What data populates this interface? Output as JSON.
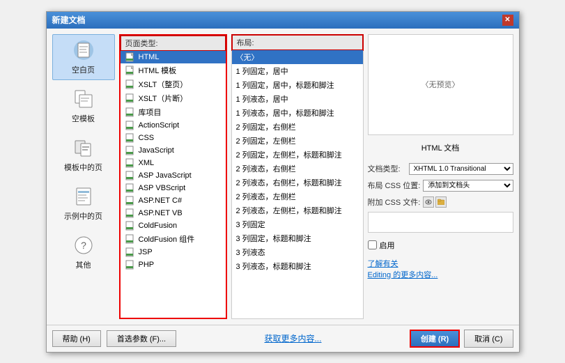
{
  "dialog": {
    "title": "新建文档",
    "close_label": "✕"
  },
  "sidebar": {
    "items": [
      {
        "id": "blank-page",
        "label": "空白页",
        "active": true
      },
      {
        "id": "blank-template",
        "label": "空模板"
      },
      {
        "id": "template-page",
        "label": "模板中的页"
      },
      {
        "id": "example-page",
        "label": "示例中的页"
      },
      {
        "id": "other",
        "label": "其他"
      }
    ]
  },
  "page_types": {
    "header": "页面类型:",
    "items": [
      {
        "id": "html",
        "label": "HTML",
        "selected": true
      },
      {
        "id": "html-template",
        "label": "HTML 模板"
      },
      {
        "id": "xslt-full",
        "label": "XSLT（整页）"
      },
      {
        "id": "xslt-fragment",
        "label": "XSLT（片断）"
      },
      {
        "id": "library",
        "label": "库项目"
      },
      {
        "id": "actionscript",
        "label": "ActionScript"
      },
      {
        "id": "css",
        "label": "CSS"
      },
      {
        "id": "javascript",
        "label": "JavaScript"
      },
      {
        "id": "xml",
        "label": "XML"
      },
      {
        "id": "asp-js",
        "label": "ASP JavaScript"
      },
      {
        "id": "asp-vbs",
        "label": "ASP VBScript"
      },
      {
        "id": "asp-net-cs",
        "label": "ASP.NET C#"
      },
      {
        "id": "asp-net-vb",
        "label": "ASP.NET VB"
      },
      {
        "id": "coldfusion",
        "label": "ColdFusion"
      },
      {
        "id": "coldfusion-component",
        "label": "ColdFusion 组件"
      },
      {
        "id": "jsp",
        "label": "JSP"
      },
      {
        "id": "php",
        "label": "PHP"
      }
    ]
  },
  "layouts": {
    "header": "布局:",
    "items": [
      {
        "id": "none",
        "label": "〈无〉",
        "selected": true
      },
      {
        "id": "1col-fixed-center",
        "label": "1 列固定，居中"
      },
      {
        "id": "1col-fixed-center-header",
        "label": "1 列固定，居中，标题和脚注"
      },
      {
        "id": "1col-fluid-center",
        "label": "1 列液态，居中"
      },
      {
        "id": "1col-fluid-center-header",
        "label": "1 列液态，居中，标题和脚注"
      },
      {
        "id": "2col-fixed-right",
        "label": "2 列固定，右侧栏"
      },
      {
        "id": "2col-fixed-left",
        "label": "2 列固定，左侧栏"
      },
      {
        "id": "2col-fixed-left-header",
        "label": "2 列固定，左侧栏，标题和脚注"
      },
      {
        "id": "2col-fluid-right",
        "label": "2 列液态，右侧栏"
      },
      {
        "id": "2col-fluid-right-header",
        "label": "2 列液态，右侧栏，标题和脚注"
      },
      {
        "id": "2col-fixed-left2",
        "label": "2 列液态，左侧栏"
      },
      {
        "id": "2col-fluid-left-header",
        "label": "2 列液态，左侧栏，标题和脚注"
      },
      {
        "id": "3col-fixed",
        "label": "3 列固定"
      },
      {
        "id": "3col-fixed-header",
        "label": "3 列固定，标题和脚注"
      },
      {
        "id": "3col-fluid",
        "label": "3 列液态"
      },
      {
        "id": "3col-fluid-header",
        "label": "3 列液态，标题和脚注"
      }
    ]
  },
  "preview": {
    "no_preview_text": "〈无预览〉",
    "doc_label": "HTML 文档"
  },
  "form": {
    "doc_type_label": "文档类型:",
    "doc_type_value": "XHTML 1.0 Transitional",
    "layout_css_label": "布局 CSS 位置:",
    "layout_css_value": "添加到文档头",
    "attach_css_label": "附加 CSS 文件:",
    "attach_css_value": "",
    "enable_label": "启用",
    "link1": "了解有关",
    "link2": "Editing 的更多内容..."
  },
  "bottom": {
    "help_label": "帮助 (H)",
    "prefs_label": "首选参数 (F)...",
    "get_more_label": "获取更多内容...",
    "create_label": "创建 (R)",
    "cancel_label": "取消 (C)"
  }
}
